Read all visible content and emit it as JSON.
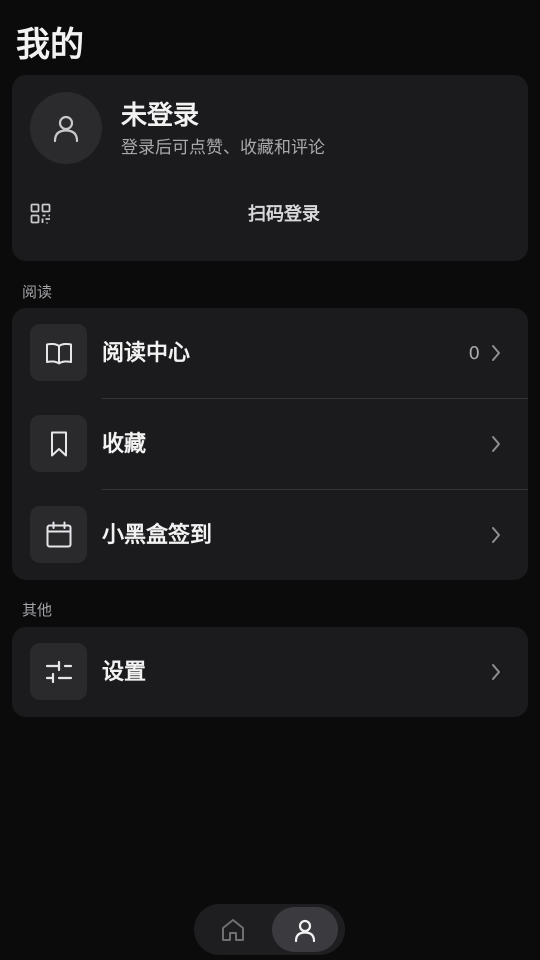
{
  "header": {
    "title": "我的"
  },
  "profile": {
    "avatar_icon": "user-icon",
    "name": "未登录",
    "subtitle": "登录后可点赞、收藏和评论",
    "qr_icon": "qr-code-icon",
    "qr_login_label": "扫码登录"
  },
  "sections": {
    "reading": {
      "label": "阅读",
      "items": [
        {
          "label": "阅读中心",
          "icon": "open-book-icon",
          "count": "0"
        },
        {
          "label": "收藏",
          "icon": "bookmark-icon"
        },
        {
          "label": "小黑盒签到",
          "icon": "calendar-icon"
        }
      ]
    },
    "other": {
      "label": "其他",
      "items": [
        {
          "label": "设置",
          "icon": "sliders-icon"
        }
      ]
    }
  },
  "bottom_nav": {
    "items": [
      {
        "icon": "home-icon",
        "active": false
      },
      {
        "icon": "user-icon",
        "active": true
      }
    ]
  },
  "colors": {
    "background": "#0b0b0b",
    "card": "#1b1b1d",
    "icon_tile": "#2a2a2d",
    "text_primary": "#f2f2f2",
    "text_secondary": "#a9a9ad"
  }
}
